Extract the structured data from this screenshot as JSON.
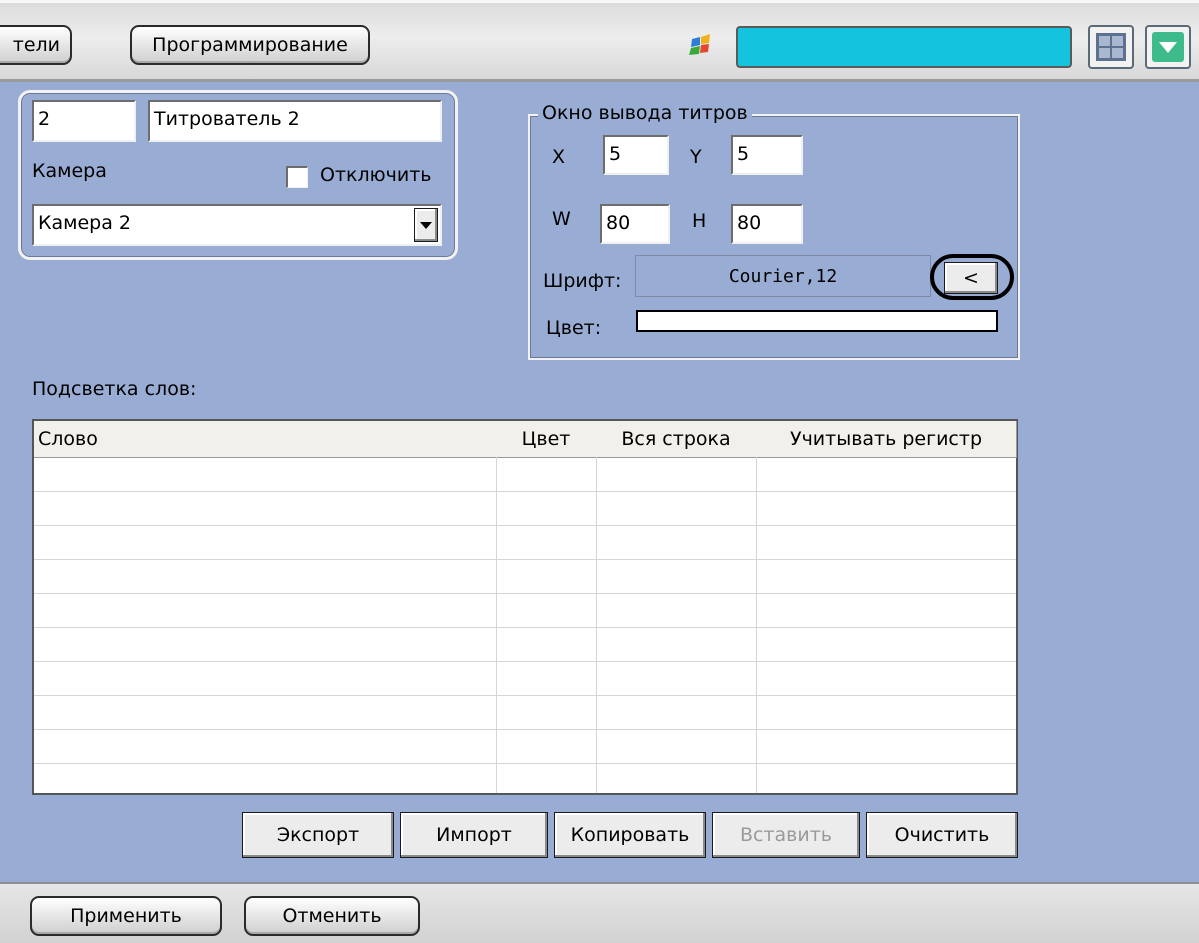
{
  "toolbar": {
    "tab_partial_label": "тели",
    "tab_programming_label": "Программирование"
  },
  "identity": {
    "id_value": "2",
    "name_value": "Титрователь 2",
    "camera_label": "Камера",
    "disable_label": "Отключить",
    "disable_checked": false,
    "camera_selected": "Камера 2"
  },
  "output_window": {
    "legend": "Окно вывода титров",
    "x_label": "X",
    "x_value": "5",
    "y_label": "Y",
    "y_value": "5",
    "w_label": "W",
    "w_value": "80",
    "h_label": "H",
    "h_value": "80",
    "font_label": "Шрифт:",
    "font_value": "Courier,12",
    "font_button_label": "<",
    "color_label": "Цвет:",
    "color_value": "#ffffff"
  },
  "highlight": {
    "title": "Подсветка слов:",
    "columns": [
      "Слово",
      "Цвет",
      "Вся строка",
      "Учитывать регистр"
    ],
    "rows": []
  },
  "actions": {
    "export_label": "Экспорт",
    "import_label": "Импорт",
    "copy_label": "Копировать",
    "paste_label": "Вставить",
    "clear_label": "Очистить"
  },
  "footer": {
    "apply_label": "Применить",
    "cancel_label": "Отменить"
  },
  "colors": {
    "panel_bg": "#99acd3",
    "accent_cyan": "#14c3dd",
    "green_button": "#3dbb8a"
  },
  "icons": {
    "toolbar_app_icon": "colored-windows-icon",
    "layout_icon": "grid-layout-icon",
    "dropdown_icon": "chevron-down-icon"
  }
}
